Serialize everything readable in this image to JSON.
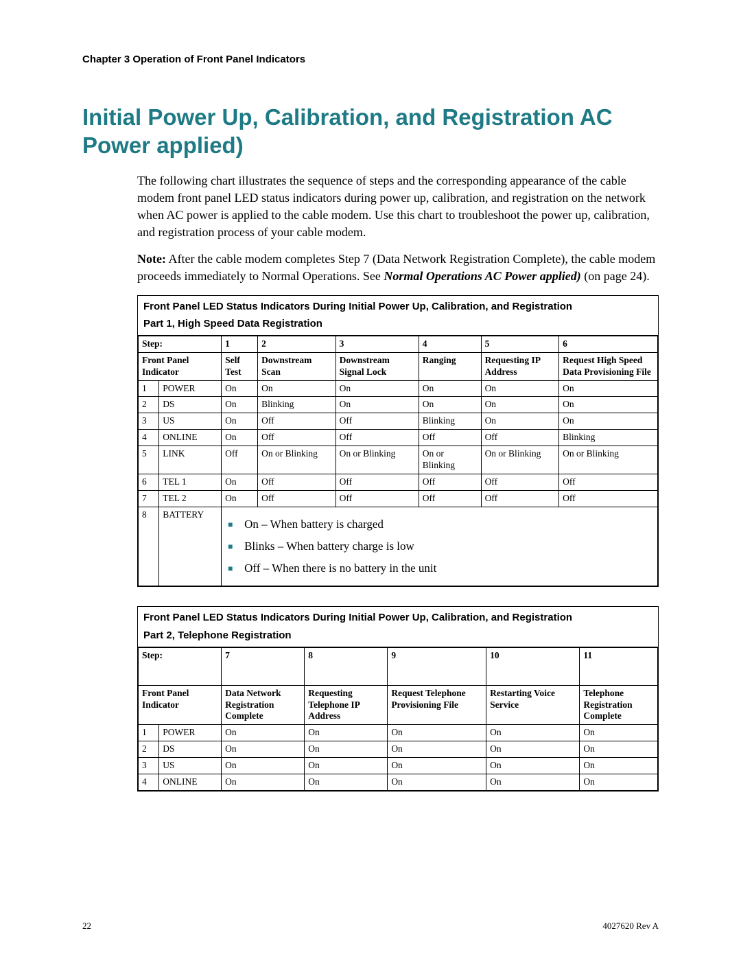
{
  "running_head": "Chapter 3    Operation of Front Panel Indicators",
  "title": "Initial Power Up, Calibration, and Registration AC Power applied)",
  "para1": "The following chart illustrates the sequence of steps and the corresponding appearance of the cable modem front panel LED status indicators during power up, calibration, and registration on the network when AC power is applied to the cable modem. Use this chart to troubleshoot the power up, calibration, and registration process of your cable modem.",
  "note_label": "Note:",
  "note_text": " After the cable modem completes Step 7 (Data Network Registration Complete), the cable modem proceeds immediately to Normal Operations. See ",
  "note_xref": "Normal Operations AC Power applied)",
  "note_tail": " (on page 24).",
  "t1": {
    "caption": "Front Panel LED Status Indicators During Initial Power Up, Calibration, and Registration",
    "subtitle": "Part 1, High Speed Data Registration",
    "step_label": "Step:",
    "steps": [
      "1",
      "2",
      "3",
      "4",
      "5",
      "6"
    ],
    "fpi_label": "Front Panel Indicator",
    "fpi_desc": [
      "Self Test",
      "Downstream Scan",
      "Downstream Signal Lock",
      "Ranging",
      "Requesting IP Address",
      "Request High Speed Data Provisioning File"
    ],
    "rows": [
      {
        "n": "1",
        "name": "POWER",
        "v": [
          "On",
          "On",
          "On",
          "On",
          "On",
          "On"
        ]
      },
      {
        "n": "2",
        "name": "DS",
        "v": [
          "On",
          "Blinking",
          "On",
          "On",
          "On",
          "On"
        ]
      },
      {
        "n": "3",
        "name": "US",
        "v": [
          "On",
          "Off",
          "Off",
          "Blinking",
          "On",
          "On"
        ]
      },
      {
        "n": "4",
        "name": "ONLINE",
        "v": [
          "On",
          "Off",
          "Off",
          "Off",
          "Off",
          "Blinking"
        ]
      },
      {
        "n": "5",
        "name": "LINK",
        "v": [
          "Off",
          "On or Blinking",
          "On or Blinking",
          "On or Blinking",
          "On or Blinking",
          "On or Blinking"
        ]
      },
      {
        "n": "6",
        "name": "TEL 1",
        "v": [
          "On",
          "Off",
          "Off",
          "Off",
          "Off",
          "Off"
        ]
      },
      {
        "n": "7",
        "name": "TEL 2",
        "v": [
          "On",
          "Off",
          "Off",
          "Off",
          "Off",
          "Off"
        ]
      }
    ],
    "battery_n": "8",
    "battery_name": "BATTERY",
    "battery_items": [
      "On – When battery is charged",
      "Blinks – When battery charge is low",
      "Off – When there is no battery in the unit"
    ]
  },
  "t2": {
    "caption": "Front Panel LED Status Indicators During Initial Power Up, Calibration, and Registration",
    "subtitle": "Part 2, Telephone Registration",
    "step_label": "Step:",
    "steps": [
      "7",
      "8",
      "9",
      "10",
      "11"
    ],
    "fpi_label": "Front Panel Indicator",
    "fpi_desc": [
      "Data Network Registration Complete",
      "Requesting Telephone IP Address",
      "Request Telephone Provisioning File",
      "Restarting Voice Service",
      "Telephone Registration Complete"
    ],
    "rows": [
      {
        "n": "1",
        "name": "POWER",
        "v": [
          "On",
          "On",
          "On",
          "On",
          "On"
        ]
      },
      {
        "n": "2",
        "name": "DS",
        "v": [
          "On",
          "On",
          "On",
          "On",
          "On"
        ]
      },
      {
        "n": "3",
        "name": "US",
        "v": [
          "On",
          "On",
          "On",
          "On",
          "On"
        ]
      },
      {
        "n": "4",
        "name": "ONLINE",
        "v": [
          "On",
          "On",
          "On",
          "On",
          "On"
        ]
      }
    ]
  },
  "footer_left": "22",
  "footer_right": "4027620 Rev A"
}
